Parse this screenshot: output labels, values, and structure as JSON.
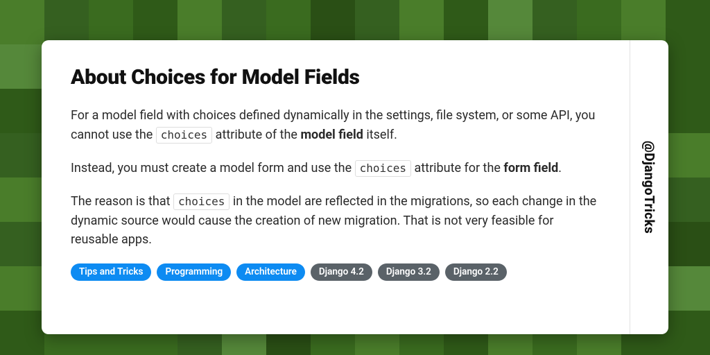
{
  "title": "About Choices for Model Fields",
  "handle": "@DjangoTricks",
  "code_token": "choices",
  "para1": {
    "pre": "For a model field with choices defined dynamically in the settings, file system, or some API, you cannot use the ",
    "mid": " attribute of the ",
    "bold": "model field",
    "post": " itself."
  },
  "para2": {
    "pre": "Instead, you must create a model form and use the ",
    "mid": " attribute for the ",
    "bold": "form field",
    "post": "."
  },
  "para3": {
    "pre": "The reason is that ",
    "post": " in the model are reflected in the migrations, so each change in the dynamic source would cause the creation of new migration. That is not very feasible for reusable apps."
  },
  "tags": [
    {
      "label": "Tips and Tricks",
      "variant": "blue"
    },
    {
      "label": "Programming",
      "variant": "blue"
    },
    {
      "label": "Architecture",
      "variant": "blue"
    },
    {
      "label": "Django 4.2",
      "variant": "gray"
    },
    {
      "label": "Django 3.2",
      "variant": "gray"
    },
    {
      "label": "Django 2.2",
      "variant": "gray"
    }
  ]
}
